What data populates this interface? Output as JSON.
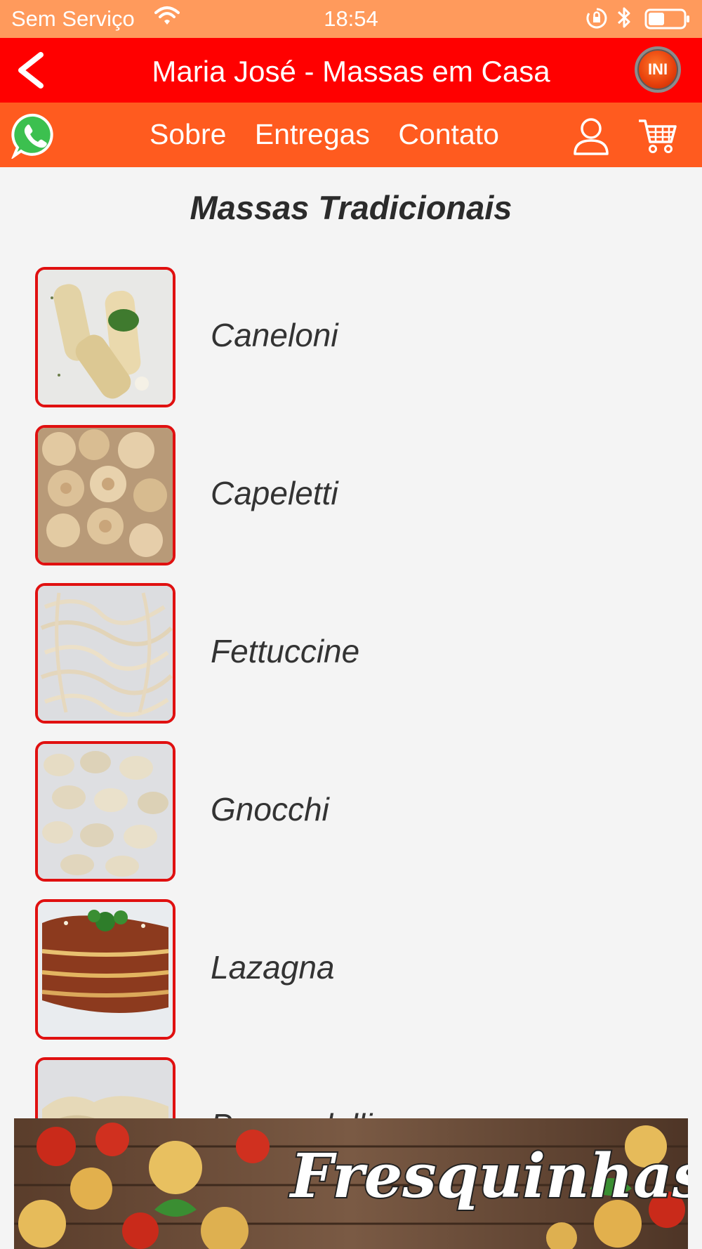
{
  "status_bar": {
    "carrier": "Sem Serviço",
    "time": "18:54",
    "icons": [
      "wifi-icon",
      "rotation-lock-icon",
      "bluetooth-icon",
      "battery-icon"
    ]
  },
  "header": {
    "title": "Maria José - Massas em Casa",
    "back_icon": "chevron-left-icon",
    "badge_label": "INI",
    "color": "#ff0000"
  },
  "nav": {
    "color": "#ff5b1f",
    "links": [
      {
        "label": "Sobre"
      },
      {
        "label": "Entregas"
      },
      {
        "label": "Contato"
      }
    ],
    "icons": [
      "whatsapp-icon",
      "user-icon",
      "cart-icon"
    ]
  },
  "section": {
    "title": "Massas Tradicionais"
  },
  "items": [
    {
      "name": "Caneloni"
    },
    {
      "name": "Capeletti"
    },
    {
      "name": "Fettuccine"
    },
    {
      "name": "Gnocchi"
    },
    {
      "name": "Lazagna"
    },
    {
      "name": "Pappardelli"
    }
  ],
  "banner": {
    "text": "Fresquinhas"
  }
}
